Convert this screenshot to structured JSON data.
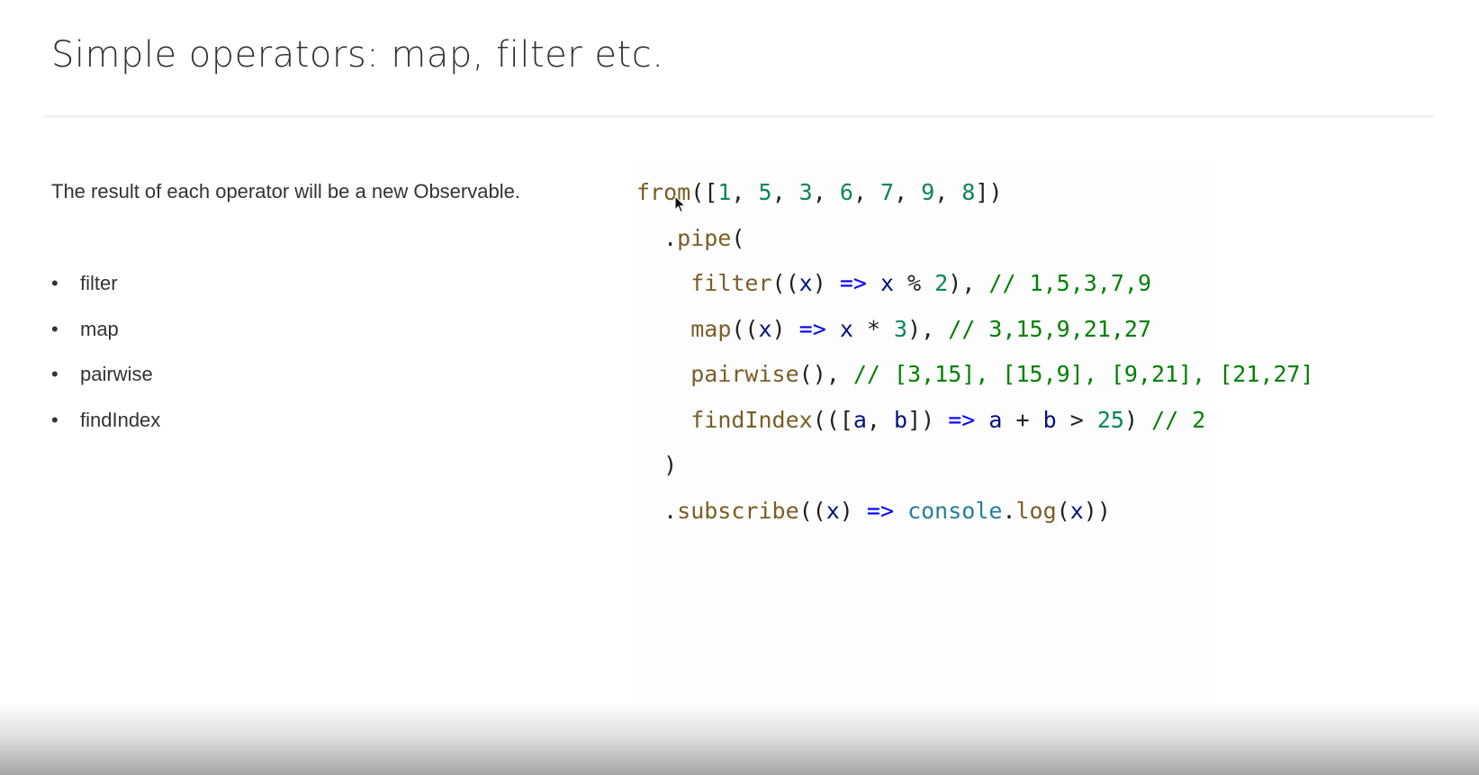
{
  "slide": {
    "title": "Simple operators: map, filter etc.",
    "intro": "The result of each operator will be a new Observable.",
    "bullets": [
      "filter",
      "map",
      "pairwise",
      "findIndex"
    ]
  },
  "code": {
    "lines": [
      [
        {
          "t": "from",
          "k": "fn"
        },
        {
          "t": "([",
          "k": "punc"
        },
        {
          "t": "1",
          "k": "num"
        },
        {
          "t": ", ",
          "k": "punc"
        },
        {
          "t": "5",
          "k": "num"
        },
        {
          "t": ", ",
          "k": "punc"
        },
        {
          "t": "3",
          "k": "num"
        },
        {
          "t": ", ",
          "k": "punc"
        },
        {
          "t": "6",
          "k": "num"
        },
        {
          "t": ", ",
          "k": "punc"
        },
        {
          "t": "7",
          "k": "num"
        },
        {
          "t": ", ",
          "k": "punc"
        },
        {
          "t": "9",
          "k": "num"
        },
        {
          "t": ", ",
          "k": "punc"
        },
        {
          "t": "8",
          "k": "num"
        },
        {
          "t": "])",
          "k": "punc"
        }
      ],
      [
        {
          "t": "  .",
          "k": "punc"
        },
        {
          "t": "pipe",
          "k": "fn"
        },
        {
          "t": "(",
          "k": "punc"
        }
      ],
      [
        {
          "t": "    ",
          "k": "punc"
        },
        {
          "t": "filter",
          "k": "fn"
        },
        {
          "t": "((",
          "k": "punc"
        },
        {
          "t": "x",
          "k": "var"
        },
        {
          "t": ") ",
          "k": "punc"
        },
        {
          "t": "=>",
          "k": "arrow"
        },
        {
          "t": " ",
          "k": "punc"
        },
        {
          "t": "x",
          "k": "var"
        },
        {
          "t": " % ",
          "k": "punc"
        },
        {
          "t": "2",
          "k": "num"
        },
        {
          "t": "), ",
          "k": "punc"
        },
        {
          "t": "// 1,5,3,7,9",
          "k": "cmt"
        }
      ],
      [
        {
          "t": "    ",
          "k": "punc"
        },
        {
          "t": "map",
          "k": "fn"
        },
        {
          "t": "((",
          "k": "punc"
        },
        {
          "t": "x",
          "k": "var"
        },
        {
          "t": ") ",
          "k": "punc"
        },
        {
          "t": "=>",
          "k": "arrow"
        },
        {
          "t": " ",
          "k": "punc"
        },
        {
          "t": "x",
          "k": "var"
        },
        {
          "t": " * ",
          "k": "punc"
        },
        {
          "t": "3",
          "k": "num"
        },
        {
          "t": "), ",
          "k": "punc"
        },
        {
          "t": "// 3,15,9,21,27",
          "k": "cmt"
        }
      ],
      [
        {
          "t": "    ",
          "k": "punc"
        },
        {
          "t": "pairwise",
          "k": "fn"
        },
        {
          "t": "(), ",
          "k": "punc"
        },
        {
          "t": "// [3,15], [15,9], [9,21], [21,27]",
          "k": "cmt"
        }
      ],
      [
        {
          "t": "    ",
          "k": "punc"
        },
        {
          "t": "findIndex",
          "k": "fn"
        },
        {
          "t": "(([",
          "k": "punc"
        },
        {
          "t": "a",
          "k": "var"
        },
        {
          "t": ", ",
          "k": "punc"
        },
        {
          "t": "b",
          "k": "var"
        },
        {
          "t": "]) ",
          "k": "punc"
        },
        {
          "t": "=>",
          "k": "arrow"
        },
        {
          "t": " ",
          "k": "punc"
        },
        {
          "t": "a",
          "k": "var"
        },
        {
          "t": " + ",
          "k": "punc"
        },
        {
          "t": "b",
          "k": "var"
        },
        {
          "t": " > ",
          "k": "punc"
        },
        {
          "t": "25",
          "k": "num"
        },
        {
          "t": ") ",
          "k": "punc"
        },
        {
          "t": "// 2",
          "k": "cmt"
        }
      ],
      [
        {
          "t": "  )",
          "k": "punc"
        }
      ],
      [
        {
          "t": "  .",
          "k": "punc"
        },
        {
          "t": "subscribe",
          "k": "fn"
        },
        {
          "t": "((",
          "k": "punc"
        },
        {
          "t": "x",
          "k": "var"
        },
        {
          "t": ") ",
          "k": "punc"
        },
        {
          "t": "=>",
          "k": "arrow"
        },
        {
          "t": " ",
          "k": "punc"
        },
        {
          "t": "console",
          "k": "cls"
        },
        {
          "t": ".",
          "k": "punc"
        },
        {
          "t": "log",
          "k": "fn"
        },
        {
          "t": "(",
          "k": "punc"
        },
        {
          "t": "x",
          "k": "var"
        },
        {
          "t": "))",
          "k": "punc"
        }
      ]
    ]
  },
  "colors": {
    "function": "#795e26",
    "number": "#098658",
    "variable": "#001080",
    "arrow": "#0000ff",
    "comment": "#008000",
    "class": "#267f99",
    "text": "#333333"
  },
  "icons": {
    "cursor": "mouse-pointer-icon"
  }
}
